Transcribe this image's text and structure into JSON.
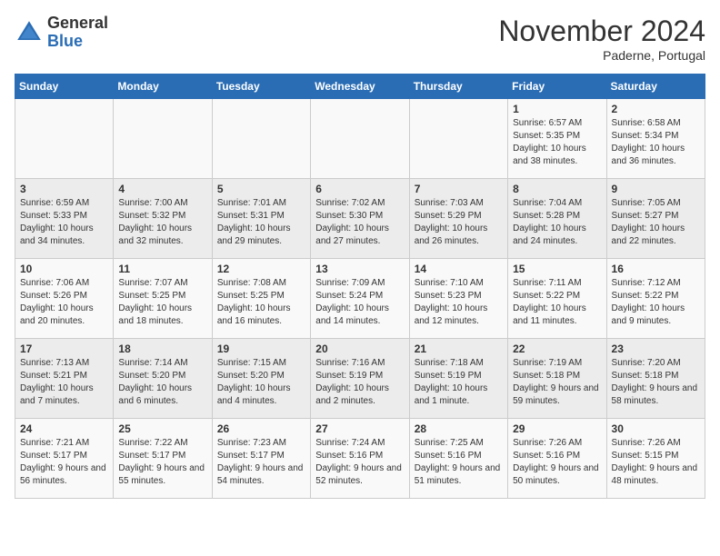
{
  "logo": {
    "general": "General",
    "blue": "Blue"
  },
  "header": {
    "month_title": "November 2024",
    "location": "Paderne, Portugal"
  },
  "weekdays": [
    "Sunday",
    "Monday",
    "Tuesday",
    "Wednesday",
    "Thursday",
    "Friday",
    "Saturday"
  ],
  "rows": [
    [
      {
        "day": "",
        "info": ""
      },
      {
        "day": "",
        "info": ""
      },
      {
        "day": "",
        "info": ""
      },
      {
        "day": "",
        "info": ""
      },
      {
        "day": "",
        "info": ""
      },
      {
        "day": "1",
        "info": "Sunrise: 6:57 AM\nSunset: 5:35 PM\nDaylight: 10 hours and 38 minutes."
      },
      {
        "day": "2",
        "info": "Sunrise: 6:58 AM\nSunset: 5:34 PM\nDaylight: 10 hours and 36 minutes."
      }
    ],
    [
      {
        "day": "3",
        "info": "Sunrise: 6:59 AM\nSunset: 5:33 PM\nDaylight: 10 hours and 34 minutes."
      },
      {
        "day": "4",
        "info": "Sunrise: 7:00 AM\nSunset: 5:32 PM\nDaylight: 10 hours and 32 minutes."
      },
      {
        "day": "5",
        "info": "Sunrise: 7:01 AM\nSunset: 5:31 PM\nDaylight: 10 hours and 29 minutes."
      },
      {
        "day": "6",
        "info": "Sunrise: 7:02 AM\nSunset: 5:30 PM\nDaylight: 10 hours and 27 minutes."
      },
      {
        "day": "7",
        "info": "Sunrise: 7:03 AM\nSunset: 5:29 PM\nDaylight: 10 hours and 26 minutes."
      },
      {
        "day": "8",
        "info": "Sunrise: 7:04 AM\nSunset: 5:28 PM\nDaylight: 10 hours and 24 minutes."
      },
      {
        "day": "9",
        "info": "Sunrise: 7:05 AM\nSunset: 5:27 PM\nDaylight: 10 hours and 22 minutes."
      }
    ],
    [
      {
        "day": "10",
        "info": "Sunrise: 7:06 AM\nSunset: 5:26 PM\nDaylight: 10 hours and 20 minutes."
      },
      {
        "day": "11",
        "info": "Sunrise: 7:07 AM\nSunset: 5:25 PM\nDaylight: 10 hours and 18 minutes."
      },
      {
        "day": "12",
        "info": "Sunrise: 7:08 AM\nSunset: 5:25 PM\nDaylight: 10 hours and 16 minutes."
      },
      {
        "day": "13",
        "info": "Sunrise: 7:09 AM\nSunset: 5:24 PM\nDaylight: 10 hours and 14 minutes."
      },
      {
        "day": "14",
        "info": "Sunrise: 7:10 AM\nSunset: 5:23 PM\nDaylight: 10 hours and 12 minutes."
      },
      {
        "day": "15",
        "info": "Sunrise: 7:11 AM\nSunset: 5:22 PM\nDaylight: 10 hours and 11 minutes."
      },
      {
        "day": "16",
        "info": "Sunrise: 7:12 AM\nSunset: 5:22 PM\nDaylight: 10 hours and 9 minutes."
      }
    ],
    [
      {
        "day": "17",
        "info": "Sunrise: 7:13 AM\nSunset: 5:21 PM\nDaylight: 10 hours and 7 minutes."
      },
      {
        "day": "18",
        "info": "Sunrise: 7:14 AM\nSunset: 5:20 PM\nDaylight: 10 hours and 6 minutes."
      },
      {
        "day": "19",
        "info": "Sunrise: 7:15 AM\nSunset: 5:20 PM\nDaylight: 10 hours and 4 minutes."
      },
      {
        "day": "20",
        "info": "Sunrise: 7:16 AM\nSunset: 5:19 PM\nDaylight: 10 hours and 2 minutes."
      },
      {
        "day": "21",
        "info": "Sunrise: 7:18 AM\nSunset: 5:19 PM\nDaylight: 10 hours and 1 minute."
      },
      {
        "day": "22",
        "info": "Sunrise: 7:19 AM\nSunset: 5:18 PM\nDaylight: 9 hours and 59 minutes."
      },
      {
        "day": "23",
        "info": "Sunrise: 7:20 AM\nSunset: 5:18 PM\nDaylight: 9 hours and 58 minutes."
      }
    ],
    [
      {
        "day": "24",
        "info": "Sunrise: 7:21 AM\nSunset: 5:17 PM\nDaylight: 9 hours and 56 minutes."
      },
      {
        "day": "25",
        "info": "Sunrise: 7:22 AM\nSunset: 5:17 PM\nDaylight: 9 hours and 55 minutes."
      },
      {
        "day": "26",
        "info": "Sunrise: 7:23 AM\nSunset: 5:17 PM\nDaylight: 9 hours and 54 minutes."
      },
      {
        "day": "27",
        "info": "Sunrise: 7:24 AM\nSunset: 5:16 PM\nDaylight: 9 hours and 52 minutes."
      },
      {
        "day": "28",
        "info": "Sunrise: 7:25 AM\nSunset: 5:16 PM\nDaylight: 9 hours and 51 minutes."
      },
      {
        "day": "29",
        "info": "Sunrise: 7:26 AM\nSunset: 5:16 PM\nDaylight: 9 hours and 50 minutes."
      },
      {
        "day": "30",
        "info": "Sunrise: 7:26 AM\nSunset: 5:15 PM\nDaylight: 9 hours and 48 minutes."
      }
    ]
  ]
}
